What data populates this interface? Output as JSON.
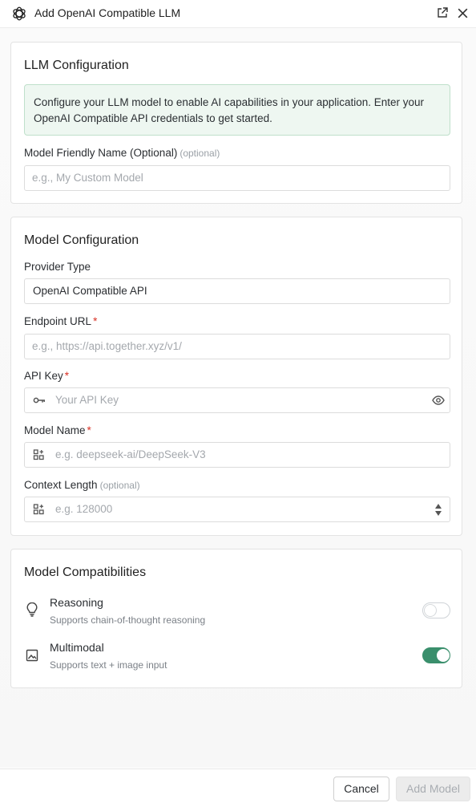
{
  "header": {
    "title": "Add OpenAI Compatible LLM"
  },
  "llm_config": {
    "title": "LLM Configuration",
    "info": "Configure your LLM model to enable AI capabilities in your application. Enter your OpenAI Compatible API credentials to get started.",
    "friendly_name_label": "Model Friendly Name (Optional)",
    "friendly_name_optional": "(optional)",
    "friendly_name_placeholder": "e.g., My Custom Model"
  },
  "model_config": {
    "title": "Model Configuration",
    "provider_label": "Provider Type",
    "provider_value": "OpenAI Compatible API",
    "endpoint_label": "Endpoint URL",
    "endpoint_placeholder": "e.g., https://api.together.xyz/v1/",
    "api_key_label": "API Key",
    "api_key_placeholder": "Your API Key",
    "model_name_label": "Model Name",
    "model_name_placeholder": "e.g. deepseek-ai/DeepSeek-V3",
    "context_label": "Context Length",
    "context_optional": "(optional)",
    "context_placeholder": "e.g. 128000",
    "required_mark": "*"
  },
  "capabilities": {
    "title": "Model Compatibilities",
    "items": [
      {
        "name": "Reasoning",
        "desc": "Supports chain-of-thought reasoning",
        "enabled": false,
        "icon": "lightbulb-icon"
      },
      {
        "name": "Multimodal",
        "desc": "Supports text + image input",
        "enabled": true,
        "icon": "image-icon"
      }
    ]
  },
  "footer": {
    "cancel_label": "Cancel",
    "add_label": "Add Model"
  },
  "colors": {
    "accent": "#3a8f6c",
    "required": "#d93025",
    "info_bg": "#eef7f1"
  }
}
